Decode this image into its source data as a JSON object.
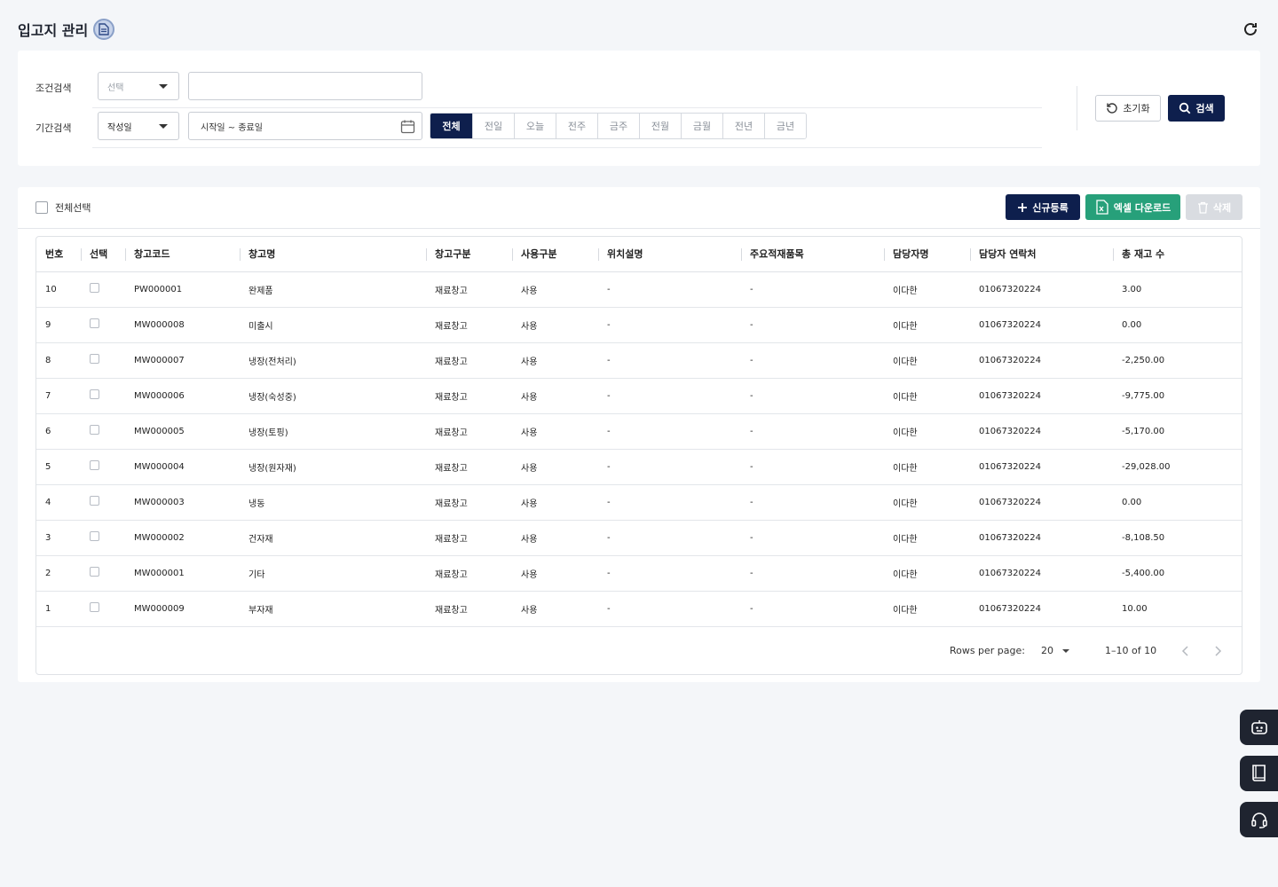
{
  "page": {
    "title": "입고지 관리"
  },
  "search": {
    "condition_label": "조건검색",
    "condition_select": "선택",
    "condition_text": "",
    "period_label": "기간검색",
    "period_select": "작성일",
    "date_range_placeholder": "시작일 ~ 종료일",
    "periods": [
      "전체",
      "전일",
      "오늘",
      "전주",
      "금주",
      "전월",
      "금월",
      "전년",
      "금년"
    ],
    "active_period": "전체",
    "reset_label": "초기화",
    "search_label": "검색"
  },
  "toolbar": {
    "select_all_label": "전체선택",
    "new_label": "신규등록",
    "excel_label": "엑셀 다운로드",
    "delete_label": "삭제"
  },
  "table": {
    "columns": [
      "번호",
      "선택",
      "창고코드",
      "창고명",
      "창고구분",
      "사용구분",
      "위치설명",
      "주요적재품목",
      "담당자명",
      "담당자 연락처",
      "총 재고 수"
    ],
    "rows": [
      {
        "no": "10",
        "code": "PW000001",
        "name": "완제품",
        "type": "재료창고",
        "use": "사용",
        "location": "-",
        "items": "-",
        "manager": "이다한",
        "phone": "01067320224",
        "stock": "3.00"
      },
      {
        "no": "9",
        "code": "MW000008",
        "name": "미출시",
        "type": "재료창고",
        "use": "사용",
        "location": "-",
        "items": "-",
        "manager": "이다한",
        "phone": "01067320224",
        "stock": "0.00"
      },
      {
        "no": "8",
        "code": "MW000007",
        "name": "냉장(전처리)",
        "type": "재료창고",
        "use": "사용",
        "location": "-",
        "items": "-",
        "manager": "이다한",
        "phone": "01067320224",
        "stock": "-2,250.00"
      },
      {
        "no": "7",
        "code": "MW000006",
        "name": "냉장(숙성중)",
        "type": "재료창고",
        "use": "사용",
        "location": "-",
        "items": "-",
        "manager": "이다한",
        "phone": "01067320224",
        "stock": "-9,775.00"
      },
      {
        "no": "6",
        "code": "MW000005",
        "name": "냉장(토핑)",
        "type": "재료창고",
        "use": "사용",
        "location": "-",
        "items": "-",
        "manager": "이다한",
        "phone": "01067320224",
        "stock": "-5,170.00"
      },
      {
        "no": "5",
        "code": "MW000004",
        "name": "냉장(원자재)",
        "type": "재료창고",
        "use": "사용",
        "location": "-",
        "items": "-",
        "manager": "이다한",
        "phone": "01067320224",
        "stock": "-29,028.00"
      },
      {
        "no": "4",
        "code": "MW000003",
        "name": "냉동",
        "type": "재료창고",
        "use": "사용",
        "location": "-",
        "items": "-",
        "manager": "이다한",
        "phone": "01067320224",
        "stock": "0.00"
      },
      {
        "no": "3",
        "code": "MW000002",
        "name": "건자재",
        "type": "재료창고",
        "use": "사용",
        "location": "-",
        "items": "-",
        "manager": "이다한",
        "phone": "01067320224",
        "stock": "-8,108.50"
      },
      {
        "no": "2",
        "code": "MW000001",
        "name": "기타",
        "type": "재료창고",
        "use": "사용",
        "location": "-",
        "items": "-",
        "manager": "이다한",
        "phone": "01067320224",
        "stock": "-5,400.00"
      },
      {
        "no": "1",
        "code": "MW000009",
        "name": "부자재",
        "type": "재료창고",
        "use": "사용",
        "location": "-",
        "items": "-",
        "manager": "이다한",
        "phone": "01067320224",
        "stock": "10.00"
      }
    ]
  },
  "pagination": {
    "rows_per_page_label": "Rows per page:",
    "rows_per_page": "20",
    "range": "1–10 of 10"
  },
  "icons": {
    "title": "document-icon",
    "refresh": "refresh-icon",
    "calendar": "calendar-icon",
    "reset": "reset-icon",
    "search": "search-icon",
    "new": "plus-icon",
    "excel": "excel-icon",
    "delete": "trash-icon",
    "prev": "chevron-left-icon",
    "next": "chevron-right-icon",
    "floating": [
      "robot-icon",
      "book-icon",
      "headset-icon"
    ]
  },
  "colors": {
    "primary": "#0e1f4d",
    "excel": "#27a07a",
    "disabled": "#d9dce1",
    "background": "#f4f6f9"
  }
}
